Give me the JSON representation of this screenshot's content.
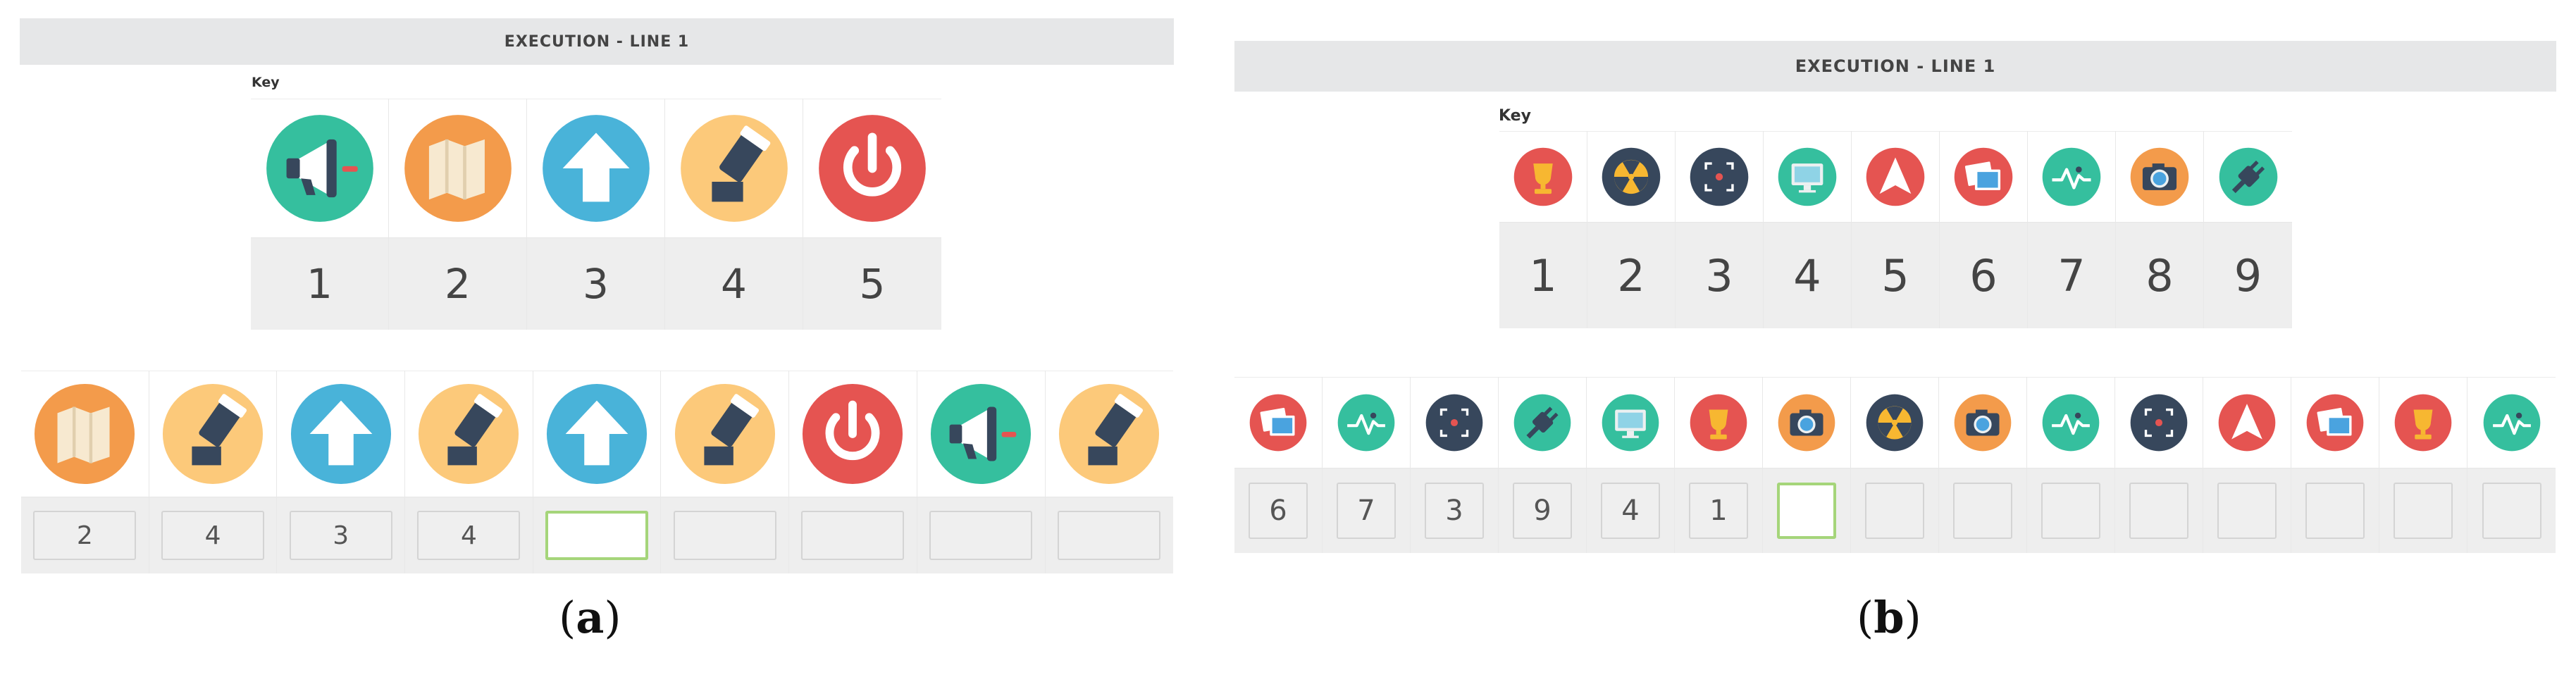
{
  "panel_a": {
    "header": "EXECUTION - LINE 1",
    "key_label": "Key",
    "key": [
      {
        "icon": "megaphone-icon",
        "number": "1"
      },
      {
        "icon": "map-icon",
        "number": "2"
      },
      {
        "icon": "arrow-up-icon",
        "number": "3"
      },
      {
        "icon": "cannon-icon",
        "number": "4"
      },
      {
        "icon": "power-icon",
        "number": "5"
      }
    ],
    "sequence": [
      {
        "icon": "map-icon",
        "answer": "2"
      },
      {
        "icon": "cannon-icon",
        "answer": "4"
      },
      {
        "icon": "arrow-up-icon",
        "answer": "3"
      },
      {
        "icon": "cannon-icon",
        "answer": "4"
      },
      {
        "icon": "arrow-up-icon",
        "answer": ""
      },
      {
        "icon": "cannon-icon",
        "answer": ""
      },
      {
        "icon": "power-icon",
        "answer": ""
      },
      {
        "icon": "megaphone-icon",
        "answer": ""
      },
      {
        "icon": "cannon-icon",
        "answer": ""
      }
    ],
    "active_index": 4,
    "caption_open": "(",
    "caption_letter": "a",
    "caption_close": ")"
  },
  "panel_b": {
    "header": "EXECUTION - LINE 1",
    "key_label": "Key",
    "key": [
      {
        "icon": "trophy-icon",
        "number": "1"
      },
      {
        "icon": "radiation-icon",
        "number": "2"
      },
      {
        "icon": "focus-target-icon",
        "number": "3"
      },
      {
        "icon": "monitor-icon",
        "number": "4"
      },
      {
        "icon": "navigation-arrow-icon",
        "number": "5"
      },
      {
        "icon": "photos-icon",
        "number": "6"
      },
      {
        "icon": "heartbeat-icon",
        "number": "7"
      },
      {
        "icon": "camera-icon",
        "number": "8"
      },
      {
        "icon": "plug-icon",
        "number": "9"
      }
    ],
    "sequence": [
      {
        "icon": "photos-icon",
        "answer": "6"
      },
      {
        "icon": "heartbeat-icon",
        "answer": "7"
      },
      {
        "icon": "focus-target-icon",
        "answer": "3"
      },
      {
        "icon": "plug-icon",
        "answer": "9"
      },
      {
        "icon": "monitor-icon",
        "answer": "4"
      },
      {
        "icon": "trophy-icon",
        "answer": "1"
      },
      {
        "icon": "camera-icon",
        "answer": ""
      },
      {
        "icon": "radiation-icon",
        "answer": ""
      },
      {
        "icon": "camera-icon",
        "answer": ""
      },
      {
        "icon": "heartbeat-icon",
        "answer": ""
      },
      {
        "icon": "focus-target-icon",
        "answer": ""
      },
      {
        "icon": "navigation-arrow-icon",
        "answer": ""
      },
      {
        "icon": "photos-icon",
        "answer": ""
      },
      {
        "icon": "trophy-icon",
        "answer": ""
      },
      {
        "icon": "heartbeat-icon",
        "answer": ""
      }
    ],
    "active_index": 6,
    "caption_open": "(",
    "caption_letter": "b",
    "caption_close": ")"
  },
  "colors": {
    "megaphone": "#35bf9e",
    "map": "#f39b4b",
    "arrow": "#49b3d9",
    "cannon": "#fcc97a",
    "power": "#e55451",
    "navy": "#37475c",
    "active_border": "#a5d57a"
  }
}
